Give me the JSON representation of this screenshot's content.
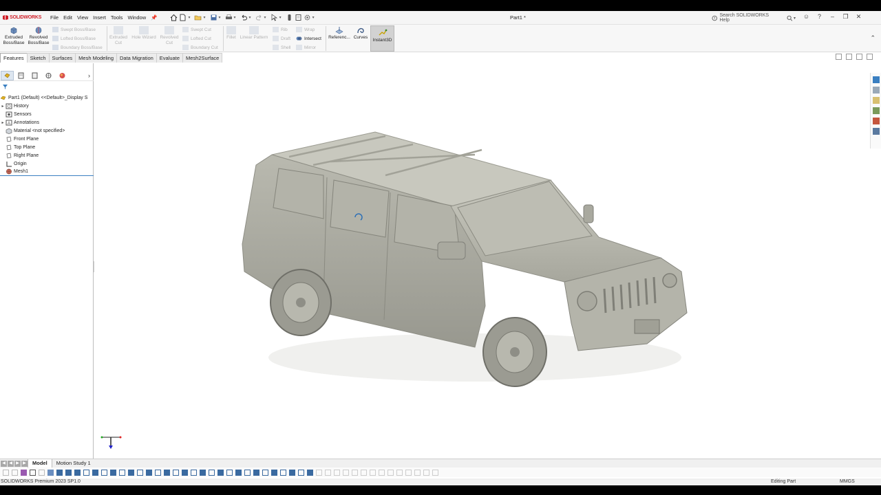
{
  "app": {
    "logo": "SOLIDWORKS",
    "menu": [
      "File",
      "Edit",
      "View",
      "Insert",
      "Tools",
      "Window"
    ],
    "document_title": "Part1 *",
    "search_placeholder": "Search SOLIDWORKS Help"
  },
  "command_manager": {
    "extruded_boss": "Extruded Boss/Base",
    "revolved_boss": "Revolved Boss/Base",
    "swept_boss": "Swept Boss/Base",
    "lofted_boss": "Lofted Boss/Base",
    "boundary_boss": "Boundary Boss/Base",
    "extruded_cut": "Extruded Cut",
    "hole_wizard": "Hole Wizard",
    "revolved_cut": "Revolved Cut",
    "swept_cut": "Swept Cut",
    "lofted_cut": "Lofted Cut",
    "boundary_cut": "Boundary Cut",
    "fillet": "Fillet",
    "linear_pattern": "Linear Pattern",
    "rib": "Rib",
    "draft": "Draft",
    "shell": "Shell",
    "wrap": "Wrap",
    "intersect": "Intersect",
    "mirror": "Mirror",
    "reference": "Referenc...",
    "curves": "Curves",
    "instant3d": "Instant3D"
  },
  "tabs": [
    "Features",
    "Sketch",
    "Surfaces",
    "Mesh Modeling",
    "Data Migration",
    "Evaluate",
    "Mesh2Surface"
  ],
  "feature_tree": {
    "root": "Part1 (Default) <<Default>_Display S",
    "items": [
      {
        "label": "History",
        "icon": "history-folder-icon",
        "expandable": true
      },
      {
        "label": "Sensors",
        "icon": "sensors-icon",
        "expandable": false
      },
      {
        "label": "Annotations",
        "icon": "annotations-icon",
        "expandable": true
      },
      {
        "label": "Material <not specified>",
        "icon": "material-icon",
        "expandable": false
      },
      {
        "label": "Front Plane",
        "icon": "plane-icon",
        "expandable": false
      },
      {
        "label": "Top Plane",
        "icon": "plane-icon",
        "expandable": false
      },
      {
        "label": "Right Plane",
        "icon": "plane-icon",
        "expandable": false
      },
      {
        "label": "Origin",
        "icon": "origin-icon",
        "expandable": false
      },
      {
        "label": "Mesh1",
        "icon": "mesh-icon",
        "expandable": false
      }
    ]
  },
  "bottom_tabs": [
    "Model",
    "Motion Study 1"
  ],
  "status": {
    "left": "SOLIDWORKS Premium 2023 SP1.0",
    "mode": "Editing Part",
    "units": "MMGS"
  },
  "colors": {
    "brand_red": "#d0202a",
    "accent_blue": "#3a7fc1",
    "model_gray": "#b8b8ae"
  }
}
